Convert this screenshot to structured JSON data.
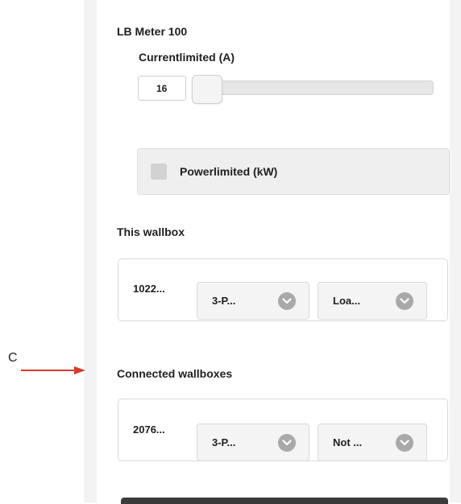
{
  "meter": {
    "title": "LB Meter 100",
    "current_label": "Currentlimited (A)",
    "current_value": "16",
    "slider_level_fraction": 0.0,
    "power_label": "Powerlimited (kW)",
    "power_checked": false
  },
  "this_wallbox": {
    "label": "This wallbox",
    "id": "1022...",
    "phase_dropdown": "3-P...",
    "mode_dropdown": "Loa..."
  },
  "connected": {
    "label": "Connected wallboxes",
    "id": "2076...",
    "phase_dropdown": "3-P...",
    "mode_dropdown": "Not ..."
  },
  "annotation": {
    "letter": "C",
    "arrow_color": "#d93a2b"
  },
  "icons": {
    "dropdown": "chevron-down-icon",
    "arrow": "arrow-right-icon"
  }
}
